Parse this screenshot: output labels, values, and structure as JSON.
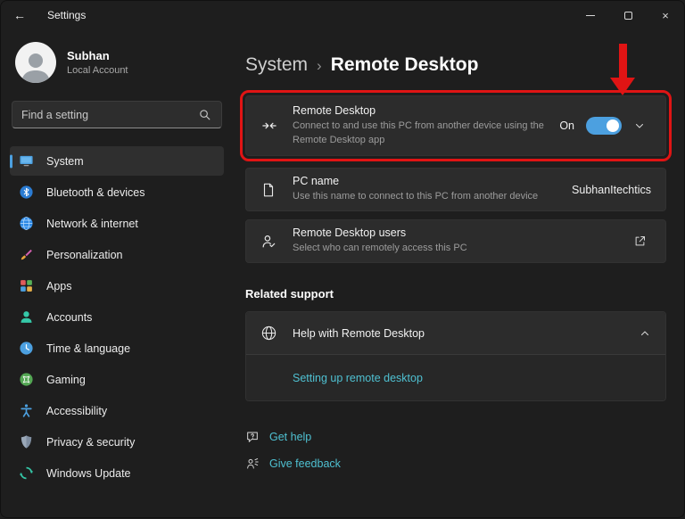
{
  "titlebar": {
    "back_glyph": "←",
    "title": "Settings",
    "close_glyph": "×"
  },
  "sidebar": {
    "account": {
      "name": "Subhan",
      "type": "Local Account"
    },
    "search": {
      "placeholder": "Find a setting"
    },
    "items": [
      {
        "label": "System",
        "icon": "system-icon",
        "selected": true
      },
      {
        "label": "Bluetooth & devices",
        "icon": "bluetooth-icon"
      },
      {
        "label": "Network & internet",
        "icon": "network-icon"
      },
      {
        "label": "Personalization",
        "icon": "personalization-icon"
      },
      {
        "label": "Apps",
        "icon": "apps-icon"
      },
      {
        "label": "Accounts",
        "icon": "accounts-icon"
      },
      {
        "label": "Time & language",
        "icon": "time-language-icon"
      },
      {
        "label": "Gaming",
        "icon": "gaming-icon"
      },
      {
        "label": "Accessibility",
        "icon": "accessibility-icon"
      },
      {
        "label": "Privacy & security",
        "icon": "privacy-icon"
      },
      {
        "label": "Windows Update",
        "icon": "windows-update-icon"
      }
    ]
  },
  "main": {
    "breadcrumb": {
      "parent": "System",
      "separator": "›",
      "current": "Remote Desktop"
    },
    "remote_desktop_card": {
      "title": "Remote Desktop",
      "description": "Connect to and use this PC from another device using the Remote Desktop app",
      "toggle_label": "On",
      "toggle_state": "on"
    },
    "pc_name_card": {
      "title": "PC name",
      "description": "Use this name to connect to this PC from another device",
      "value": "SubhanItechtics"
    },
    "users_card": {
      "title": "Remote Desktop users",
      "description": "Select who can remotely access this PC"
    },
    "related_support": {
      "heading": "Related support",
      "help_card": {
        "title": "Help with Remote Desktop",
        "expanded": true
      },
      "link": "Setting up remote desktop"
    },
    "footer": {
      "get_help": "Get help",
      "give_feedback": "Give feedback"
    }
  },
  "annotation": {
    "color": "#e01414",
    "type": "red-arrow-and-box",
    "highlighted_card": "Remote Desktop"
  },
  "colors": {
    "accent": "#4ca0e0",
    "link": "#4fc1d2",
    "card_bg": "#2c2c2c",
    "window_bg": "#1e1e1e"
  }
}
